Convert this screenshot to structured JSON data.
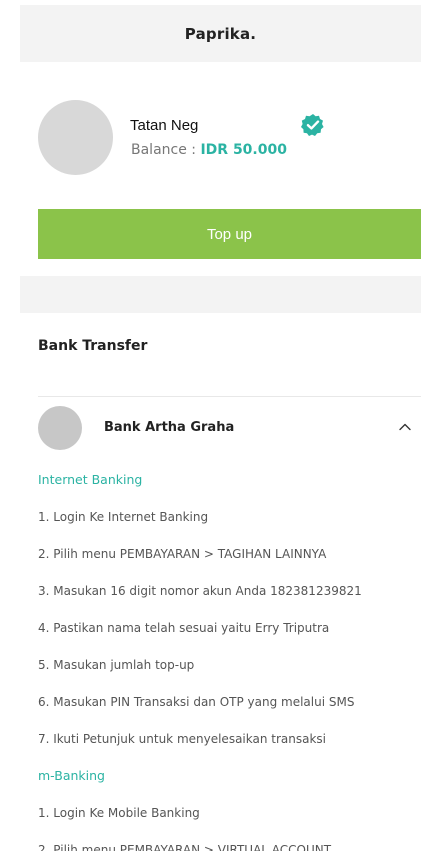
{
  "header": {
    "title": "Paprika."
  },
  "profile": {
    "name": "Tatan Neg",
    "balance_label": "Balance : ",
    "balance_amount": "IDR 50.000",
    "verified_icon": "verified-badge-icon",
    "accent_color": "#2bb3a3"
  },
  "topup": {
    "label": "Top up",
    "color": "#8bc34a"
  },
  "bank_transfer": {
    "section_title": "Bank Transfer",
    "bank": {
      "name": "Bank Artha Graha",
      "expanded_icon": "chevron-up-icon",
      "methods": [
        {
          "title": "Internet Banking",
          "steps": [
            "1. Login Ke Internet Banking",
            "2. Pilih menu PEMBAYARAN > TAGIHAN LAINNYA",
            "3. Masukan 16 digit nomor akun Anda  182381239821",
            "4. Pastikan nama telah sesuai yaitu Erry Triputra",
            "5. Masukan jumlah top-up",
            "6. Masukan PIN Transaksi dan OTP yang melalui SMS",
            "7. Ikuti Petunjuk untuk menyelesaikan transaksi"
          ]
        },
        {
          "title": "m-Banking",
          "steps": [
            "1. Login Ke Mobile Banking",
            "2. Pilih menu PEMBAYARAN > VIRTUAL ACCOUNT"
          ]
        }
      ]
    }
  }
}
